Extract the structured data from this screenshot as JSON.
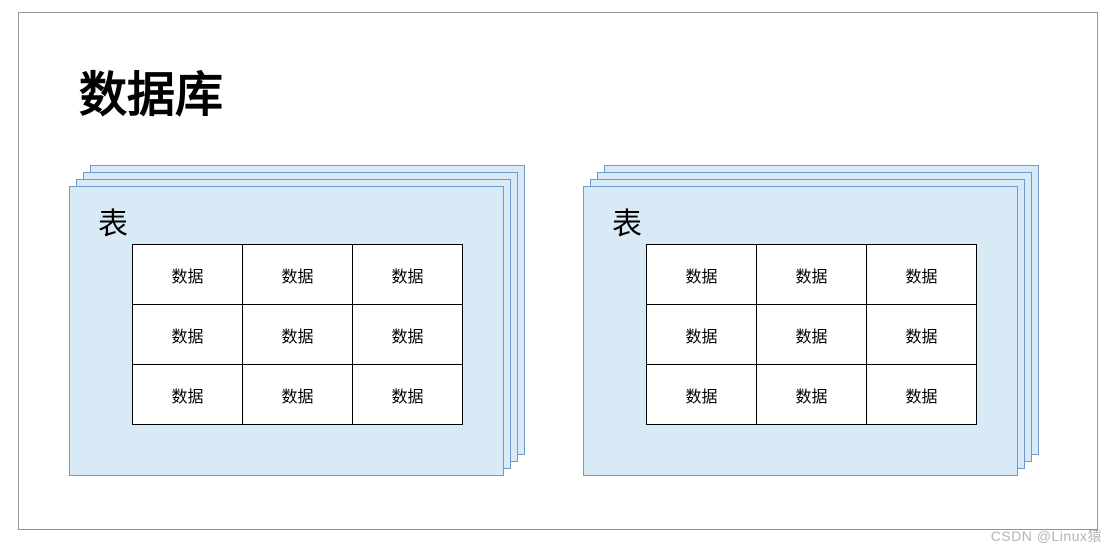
{
  "diagram": {
    "title": "数据库",
    "stacks": [
      {
        "label": "表",
        "cells": [
          [
            "数据",
            "数据",
            "数据"
          ],
          [
            "数据",
            "数据",
            "数据"
          ],
          [
            "数据",
            "数据",
            "数据"
          ]
        ]
      },
      {
        "label": "表",
        "cells": [
          [
            "数据",
            "数据",
            "数据"
          ],
          [
            "数据",
            "数据",
            "数据"
          ],
          [
            "数据",
            "数据",
            "数据"
          ]
        ]
      }
    ]
  },
  "watermark": "CSDN @Linux猿"
}
